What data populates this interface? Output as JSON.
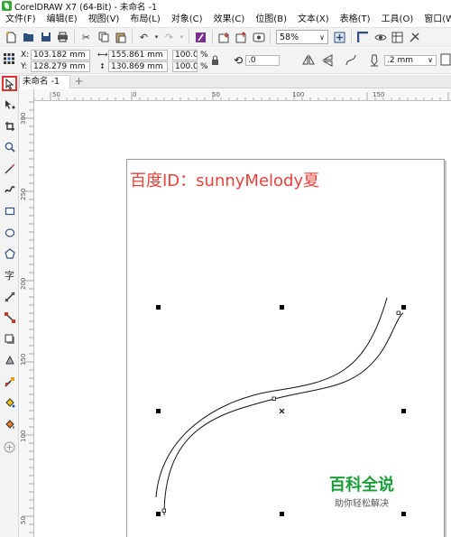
{
  "window": {
    "title": "CorelDRAW X7 (64-Bit) - 未命名 -1"
  },
  "menu": [
    "文件(F)",
    "编辑(E)",
    "视图(V)",
    "布局(L)",
    "对象(C)",
    "效果(C)",
    "位图(B)",
    "文本(X)",
    "表格(T)",
    "工具(O)",
    "窗口(W)"
  ],
  "toolbar": {
    "zoom": "58%"
  },
  "properties": {
    "x_label": "X:",
    "x": "103.182 mm",
    "y_label": "Y:",
    "y": "128.279 mm",
    "width": "155.861 mm",
    "height": "130.869 mm",
    "scale_x": "100.0",
    "scale_y": "100.0",
    "percent": "%",
    "rotation": ".0",
    "outline_width": ".2 mm"
  },
  "tabs": {
    "document": "未命名 -1",
    "add": "+"
  },
  "rulers": {
    "h": [
      {
        "label": "50"
      },
      {
        "label": "0"
      },
      {
        "label": "50"
      },
      {
        "label": "100"
      },
      {
        "label": "150"
      },
      {
        "label": "200"
      }
    ],
    "v": [
      {
        "label": "300"
      },
      {
        "label": "250"
      },
      {
        "label": "200"
      },
      {
        "label": "150"
      },
      {
        "label": "100"
      },
      {
        "label": "50"
      }
    ]
  },
  "watermark": {
    "id_text": "百度ID：sunnyMelody夏",
    "logo_main": "百科全说",
    "logo_sub": "助你轻松解决"
  },
  "colors": {
    "accent_red": "#e8423a",
    "logo_green": "#1a9e37",
    "selection_red": "#e53030"
  }
}
